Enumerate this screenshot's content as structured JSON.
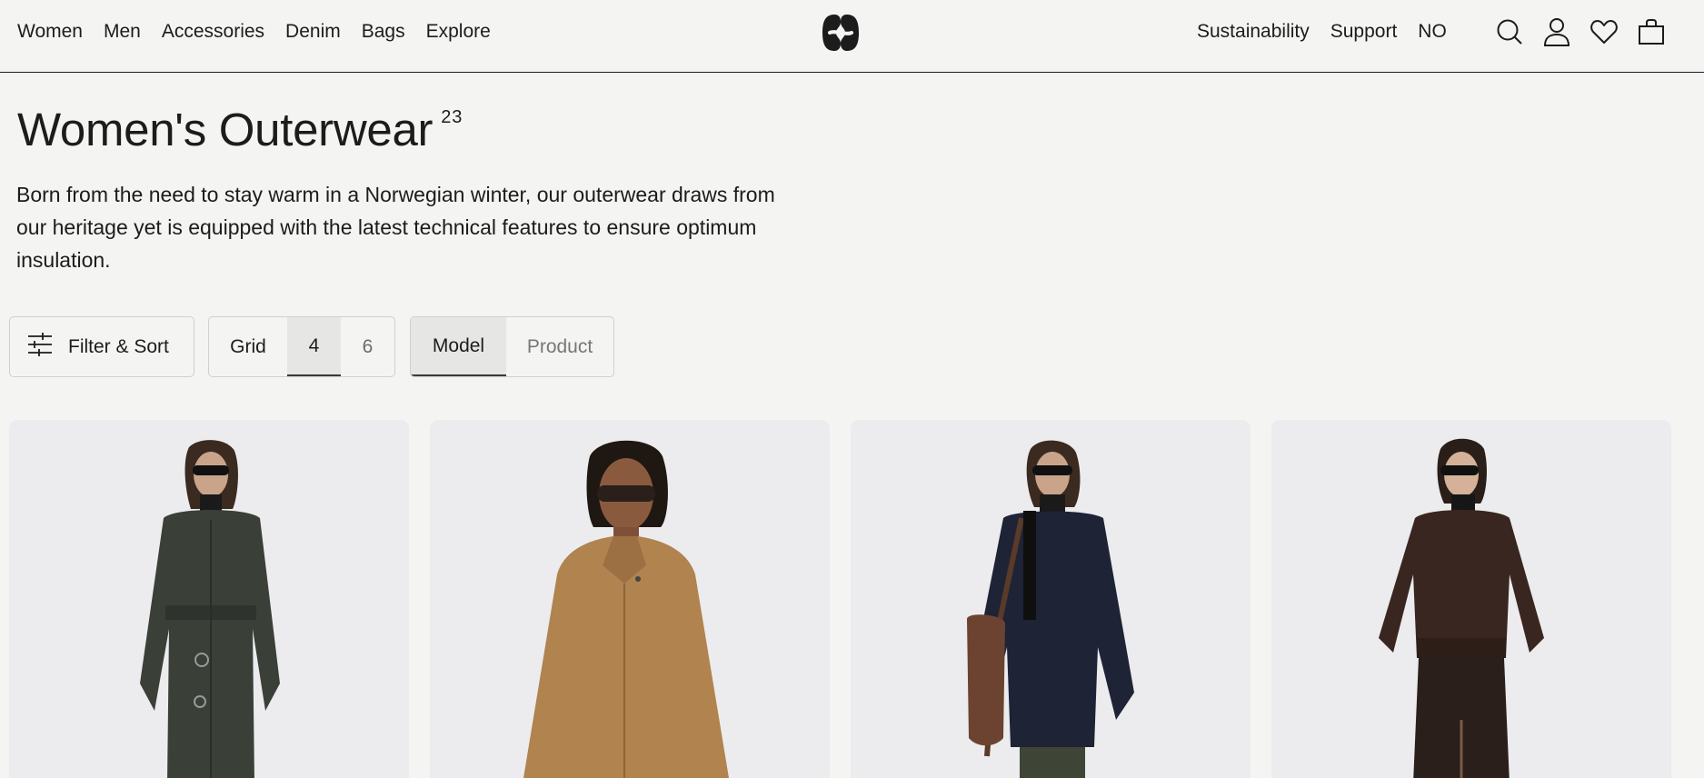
{
  "header": {
    "nav_left": [
      "Women",
      "Men",
      "Accessories",
      "Denim",
      "Bags",
      "Explore"
    ],
    "nav_right": [
      "Sustainability",
      "Support",
      "NO"
    ],
    "icons": [
      "search-icon",
      "account-icon",
      "wishlist-icon",
      "bag-icon"
    ],
    "logo": "brand-logo"
  },
  "page": {
    "title": "Women's Outerwear",
    "count": "23",
    "description": "Born from the need to stay warm in a Norwegian winter, our outerwear draws from our heritage yet is equipped with the latest technical features to ensure optimum insulation."
  },
  "controls": {
    "filter_label": "Filter & Sort",
    "grid_label": "Grid",
    "grid_options": [
      "4",
      "6"
    ],
    "grid_selected": "4",
    "view_options": [
      "Model",
      "Product"
    ],
    "view_selected": "Model"
  },
  "products": [
    {
      "name": "product-card-1",
      "coat_color": "#3a3f38"
    },
    {
      "name": "product-card-2",
      "coat_color": "#b0834f"
    },
    {
      "name": "product-card-3",
      "coat_color": "#1e2336"
    },
    {
      "name": "product-card-4",
      "coat_color": "#3a2620"
    }
  ],
  "colors": {
    "background": "#f4f4f2",
    "text": "#1c1c1c",
    "card_bg": "#e7e7e9"
  }
}
